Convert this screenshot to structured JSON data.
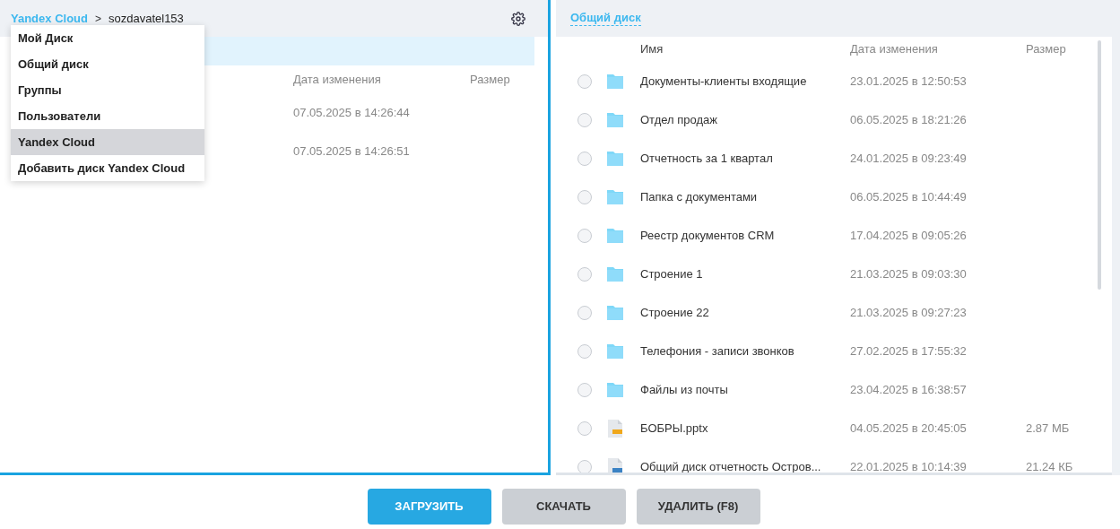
{
  "left_panel": {
    "breadcrumb": {
      "root": "Yandex Cloud",
      "separator": ">",
      "current": "sozdavatel153"
    },
    "columns": {
      "date": "Дата изменения",
      "size": "Размер"
    },
    "rows": [
      {
        "date": "07.05.2025 в 14:26:44"
      },
      {
        "date": "07.05.2025 в 14:26:51"
      }
    ],
    "menu": [
      {
        "label": "Мой Диск",
        "selected": false
      },
      {
        "label": "Общий диск",
        "selected": false
      },
      {
        "label": "Группы",
        "selected": false
      },
      {
        "label": "Пользователи",
        "selected": false
      },
      {
        "label": "Yandex Cloud",
        "selected": true
      },
      {
        "label": "Добавить диск Yandex Cloud",
        "selected": false
      }
    ]
  },
  "right_panel": {
    "title": "Общий диск",
    "columns": {
      "name": "Имя",
      "date": "Дата изменения",
      "size": "Размер"
    },
    "rows": [
      {
        "kind": "folder",
        "name": "Документы-клиенты входящие",
        "date": "23.01.2025 в 12:50:53",
        "selected": false
      },
      {
        "kind": "folder",
        "name": "Отдел продаж",
        "date": "06.05.2025 в 18:21:26",
        "selected": false
      },
      {
        "kind": "folder",
        "name": "Отчетность за 1 квартал",
        "date": "24.01.2025 в 09:23:49",
        "selected": false
      },
      {
        "kind": "folder",
        "name": "Папка с документами",
        "date": "06.05.2025 в 10:44:49",
        "selected": false
      },
      {
        "kind": "folder",
        "name": "Реестр документов CRM",
        "date": "17.04.2025 в 09:05:26",
        "selected": false
      },
      {
        "kind": "folder",
        "name": "Строение 1",
        "date": "21.03.2025 в 09:03:30",
        "selected": false
      },
      {
        "kind": "folder",
        "name": "Строение 22",
        "date": "21.03.2025 в 09:27:23",
        "selected": false
      },
      {
        "kind": "folder",
        "name": "Телефония - записи звонков",
        "date": "27.02.2025 в 17:55:32",
        "selected": false
      },
      {
        "kind": "folder",
        "name": "Файлы из почты",
        "date": "23.04.2025 в 16:38:57",
        "selected": false
      },
      {
        "kind": "presentation",
        "name": "БОБРЫ.pptx",
        "date": "04.05.2025 в 20:45:05",
        "size": "2.87 МБ",
        "selected": false
      },
      {
        "kind": "document",
        "name": "Общий диск отчетность Остров...",
        "date": "22.01.2025 в 10:14:39",
        "size": "21.24 КБ",
        "selected": false
      }
    ]
  },
  "buttons": [
    {
      "label": "ЗАГРУЗИТЬ",
      "kind": "primary"
    },
    {
      "label": "СКАЧАТЬ",
      "kind": "secondary"
    },
    {
      "label": "УДАЛИТЬ (F8)",
      "kind": "secondary"
    }
  ]
}
